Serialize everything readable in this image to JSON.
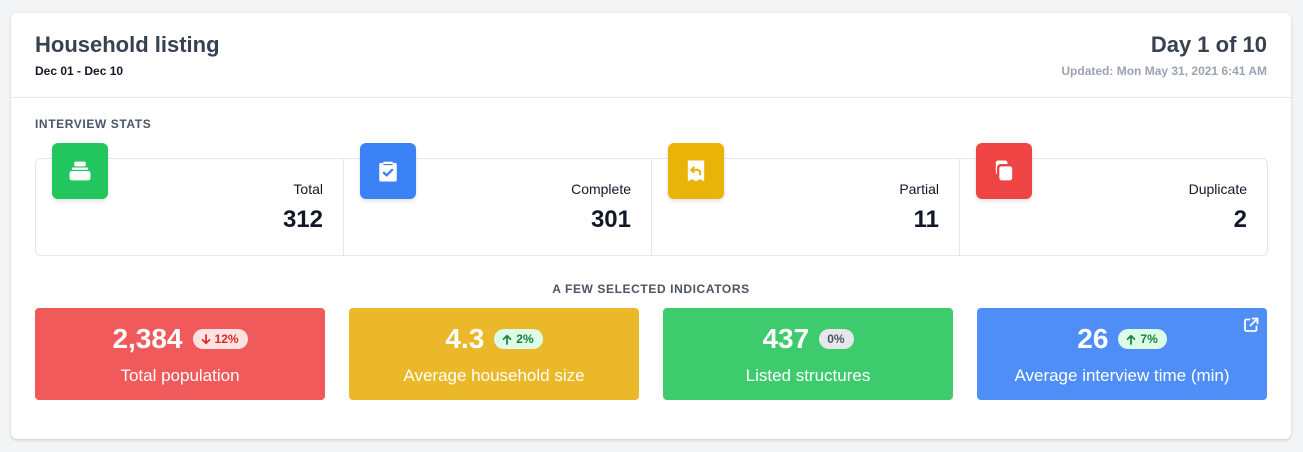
{
  "header": {
    "title": "Household listing",
    "date_range": "Dec 01 - Dec 10",
    "day": "Day 1 of 10",
    "updated": "Updated: Mon May 31, 2021 6:41 AM"
  },
  "interview_stats": {
    "title": "INTERVIEW STATS",
    "items": [
      {
        "label": "Total",
        "value": "312",
        "icon": "inbox-stack-icon",
        "color": "#22c55e"
      },
      {
        "label": "Complete",
        "value": "301",
        "icon": "clipboard-check-icon",
        "color": "#3b82f6"
      },
      {
        "label": "Partial",
        "value": "11",
        "icon": "receipt-refund-icon",
        "color": "#eab308"
      },
      {
        "label": "Duplicate",
        "value": "2",
        "icon": "duplicate-icon",
        "color": "#ef4444"
      }
    ]
  },
  "indicators": {
    "title": "A FEW SELECTED INDICATORS",
    "items": [
      {
        "value": "2,384",
        "change": "12%",
        "direction": "down",
        "label": "Total population",
        "color": "#f05a5a"
      },
      {
        "value": "4.3",
        "change": "2%",
        "direction": "up",
        "label": "Average household size",
        "color": "#ebb82a"
      },
      {
        "value": "437",
        "change": "0%",
        "direction": "none",
        "label": "Listed structures",
        "color": "#3ecb6e"
      },
      {
        "value": "26",
        "change": "7%",
        "direction": "up",
        "label": "Average interview time (min)",
        "color": "#4f8ef7",
        "link_icon": "external-link-icon"
      }
    ]
  }
}
